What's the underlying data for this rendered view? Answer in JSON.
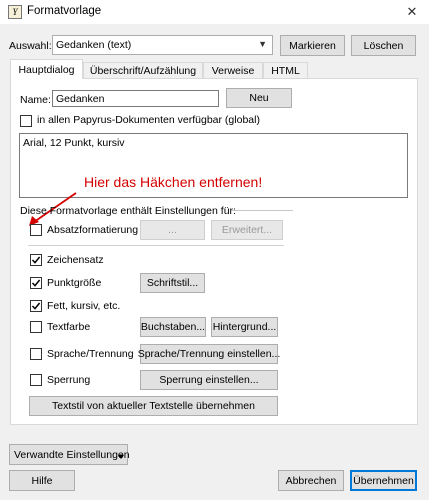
{
  "window": {
    "title": "Formatvorlage",
    "close_symbol": "✕"
  },
  "top": {
    "auswahl_label": "Auswahl:",
    "auswahl_value": "Gedanken (text)",
    "markieren": "Markieren",
    "loeschen": "Löschen"
  },
  "tabs": [
    {
      "label": "Hauptdialog",
      "active": true
    },
    {
      "label": "Überschrift/Aufzählung",
      "active": false
    },
    {
      "label": "Verweise",
      "active": false
    },
    {
      "label": "HTML",
      "active": false
    }
  ],
  "main": {
    "name_label": "Name:",
    "name_value": "Gedanken",
    "neu": "Neu",
    "global_label": "in allen Papyrus-Dokumenten verfügbar (global)",
    "description": "Arial, 12 Punkt, kursiv",
    "annotation": "Hier das Häkchen entfernen!",
    "annotation_color": "#d40000",
    "section_label": "Diese Formatvorlage enthält Einstellungen für:",
    "absatz_label": "Absatzformatierung",
    "dots_button": "...",
    "erweitert_button": "Erweitert...",
    "zeichensatz_label": "Zeichensatz",
    "punktgroesse_label": "Punktgröße",
    "schriftstil_button": "Schriftstil...",
    "fett_label": "Fett, kursiv, etc.",
    "textfarbe_label": "Textfarbe",
    "buchstaben_button": "Buchstaben...",
    "hintergrund_button": "Hintergrund...",
    "sprache_label": "Sprache/Trennung",
    "sprache_button": "Sprache/Trennung einstellen...",
    "sperrung_label": "Sperrung",
    "sperrung_button": "Sperrung einstellen...",
    "uebernehmen_button": "Textstil von aktueller Textstelle übernehmen"
  },
  "checkboxes": {
    "global": false,
    "absatz": false,
    "zeichensatz": true,
    "punktgroesse": true,
    "fett": true,
    "textfarbe": false,
    "sprache": false,
    "sperrung": false
  },
  "bottom": {
    "verwandte": "Verwandte Einstellungen",
    "hilfe": "Hilfe",
    "abbrechen": "Abbrechen",
    "uebernehmen": "Übernehmen"
  }
}
